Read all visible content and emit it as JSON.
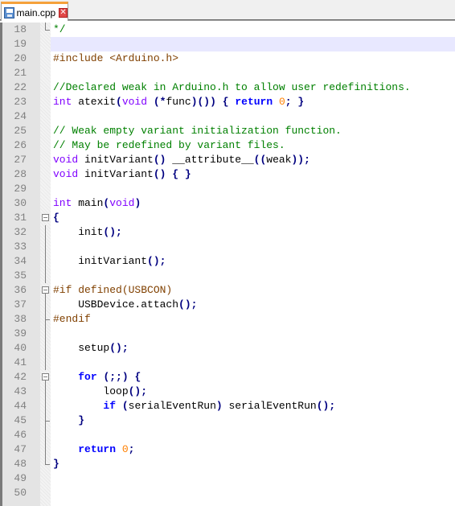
{
  "tab": {
    "filename": "main.cpp",
    "icon": "save-disk-icon",
    "close_icon": "close-icon",
    "close_glyph": "✕"
  },
  "colors": {
    "keyword_type": "#8000FF",
    "keyword_flow": "#0000FF",
    "comment": "#008000",
    "preprocessor": "#804000",
    "number": "#FF8000",
    "operator": "#000080",
    "current_line_bg": "#E8E8FF",
    "tab_accent": "#F5A13B"
  },
  "editor": {
    "current_line": 19,
    "lines": [
      {
        "n": "18",
        "fold": "end",
        "tokens": [
          {
            "t": "cm",
            "v": "*/"
          }
        ]
      },
      {
        "n": "19",
        "fold": "",
        "tokens": []
      },
      {
        "n": "20",
        "fold": "",
        "tokens": [
          {
            "t": "pp",
            "v": "#include <Arduino.h>"
          }
        ]
      },
      {
        "n": "21",
        "fold": "",
        "tokens": []
      },
      {
        "n": "22",
        "fold": "",
        "tokens": [
          {
            "t": "cm",
            "v": "//Declared weak in Arduino.h to allow user redefinitions."
          }
        ]
      },
      {
        "n": "23",
        "fold": "",
        "tokens": [
          {
            "t": "kw",
            "v": "int"
          },
          {
            "t": "id",
            "v": " atexit"
          },
          {
            "t": "op",
            "v": "("
          },
          {
            "t": "kw",
            "v": "void"
          },
          {
            "t": "id",
            "v": " "
          },
          {
            "t": "op",
            "v": "(*"
          },
          {
            "t": "id",
            "v": "func"
          },
          {
            "t": "op",
            "v": ")())"
          },
          {
            "t": "id",
            "v": " "
          },
          {
            "t": "op",
            "v": "{"
          },
          {
            "t": "id",
            "v": " "
          },
          {
            "t": "kw2",
            "v": "return"
          },
          {
            "t": "id",
            "v": " "
          },
          {
            "t": "num",
            "v": "0"
          },
          {
            "t": "op",
            "v": ";"
          },
          {
            "t": "id",
            "v": " "
          },
          {
            "t": "op",
            "v": "}"
          }
        ]
      },
      {
        "n": "24",
        "fold": "",
        "tokens": []
      },
      {
        "n": "25",
        "fold": "",
        "tokens": [
          {
            "t": "cm",
            "v": "// Weak empty variant initialization function."
          }
        ]
      },
      {
        "n": "26",
        "fold": "",
        "tokens": [
          {
            "t": "cm",
            "v": "// May be redefined by variant files."
          }
        ]
      },
      {
        "n": "27",
        "fold": "",
        "tokens": [
          {
            "t": "kw",
            "v": "void"
          },
          {
            "t": "id",
            "v": " initVariant"
          },
          {
            "t": "op",
            "v": "()"
          },
          {
            "t": "id",
            "v": " __attribute__"
          },
          {
            "t": "op",
            "v": "(("
          },
          {
            "t": "id",
            "v": "weak"
          },
          {
            "t": "op",
            "v": "));"
          }
        ]
      },
      {
        "n": "28",
        "fold": "",
        "tokens": [
          {
            "t": "kw",
            "v": "void"
          },
          {
            "t": "id",
            "v": " initVariant"
          },
          {
            "t": "op",
            "v": "()"
          },
          {
            "t": "id",
            "v": " "
          },
          {
            "t": "op",
            "v": "{"
          },
          {
            "t": "id",
            "v": " "
          },
          {
            "t": "op",
            "v": "}"
          }
        ]
      },
      {
        "n": "29",
        "fold": "",
        "tokens": []
      },
      {
        "n": "30",
        "fold": "",
        "tokens": [
          {
            "t": "kw",
            "v": "int"
          },
          {
            "t": "id",
            "v": " main"
          },
          {
            "t": "op",
            "v": "("
          },
          {
            "t": "kw",
            "v": "void"
          },
          {
            "t": "op",
            "v": ")"
          }
        ]
      },
      {
        "n": "31",
        "fold": "box",
        "tokens": [
          {
            "t": "op",
            "v": "{"
          }
        ]
      },
      {
        "n": "32",
        "fold": "vline",
        "tokens": [
          {
            "t": "id",
            "v": "    init"
          },
          {
            "t": "op",
            "v": "();"
          }
        ]
      },
      {
        "n": "33",
        "fold": "vline",
        "tokens": []
      },
      {
        "n": "34",
        "fold": "vline",
        "tokens": [
          {
            "t": "id",
            "v": "    initVariant"
          },
          {
            "t": "op",
            "v": "();"
          }
        ]
      },
      {
        "n": "35",
        "fold": "vline",
        "tokens": []
      },
      {
        "n": "36",
        "fold": "boxcont",
        "tokens": [
          {
            "t": "pp",
            "v": "#if defined(USBCON)"
          }
        ]
      },
      {
        "n": "37",
        "fold": "vline",
        "tokens": [
          {
            "t": "id",
            "v": "    USBDevice.attach"
          },
          {
            "t": "op",
            "v": "();"
          }
        ]
      },
      {
        "n": "38",
        "fold": "mid",
        "tokens": [
          {
            "t": "pp",
            "v": "#endif"
          }
        ]
      },
      {
        "n": "39",
        "fold": "vline",
        "tokens": []
      },
      {
        "n": "40",
        "fold": "vline",
        "tokens": [
          {
            "t": "id",
            "v": "    setup"
          },
          {
            "t": "op",
            "v": "();"
          }
        ]
      },
      {
        "n": "41",
        "fold": "vline",
        "tokens": []
      },
      {
        "n": "42",
        "fold": "boxcont",
        "tokens": [
          {
            "t": "id",
            "v": "    "
          },
          {
            "t": "kw2",
            "v": "for"
          },
          {
            "t": "id",
            "v": " "
          },
          {
            "t": "op",
            "v": "(;;)"
          },
          {
            "t": "id",
            "v": " "
          },
          {
            "t": "op",
            "v": "{"
          }
        ]
      },
      {
        "n": "43",
        "fold": "vline",
        "tokens": [
          {
            "t": "id",
            "v": "        loop"
          },
          {
            "t": "op",
            "v": "();"
          }
        ]
      },
      {
        "n": "44",
        "fold": "vline",
        "tokens": [
          {
            "t": "id",
            "v": "        "
          },
          {
            "t": "kw2",
            "v": "if"
          },
          {
            "t": "id",
            "v": " "
          },
          {
            "t": "op",
            "v": "("
          },
          {
            "t": "id",
            "v": "serialEventRun"
          },
          {
            "t": "op",
            "v": ")"
          },
          {
            "t": "id",
            "v": " serialEventRun"
          },
          {
            "t": "op",
            "v": "();"
          }
        ]
      },
      {
        "n": "45",
        "fold": "mid",
        "tokens": [
          {
            "t": "id",
            "v": "    "
          },
          {
            "t": "op",
            "v": "}"
          }
        ]
      },
      {
        "n": "46",
        "fold": "vline",
        "tokens": []
      },
      {
        "n": "47",
        "fold": "vline",
        "tokens": [
          {
            "t": "id",
            "v": "    "
          },
          {
            "t": "kw2",
            "v": "return"
          },
          {
            "t": "id",
            "v": " "
          },
          {
            "t": "num",
            "v": "0"
          },
          {
            "t": "op",
            "v": ";"
          }
        ]
      },
      {
        "n": "48",
        "fold": "end",
        "tokens": [
          {
            "t": "op",
            "v": "}"
          }
        ]
      },
      {
        "n": "49",
        "fold": "",
        "tokens": []
      },
      {
        "n": "50",
        "fold": "",
        "tokens": []
      }
    ]
  }
}
